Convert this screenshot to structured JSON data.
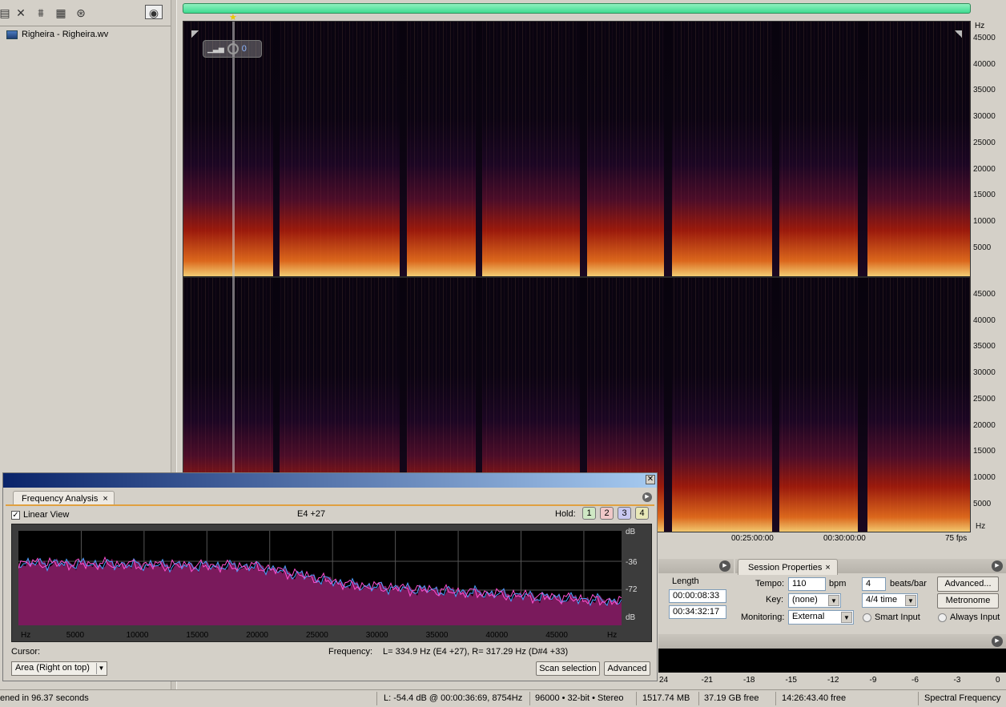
{
  "file_panel": {
    "file_name": "Righeira - Righeira.wv"
  },
  "spectral": {
    "hz_unit": "Hz",
    "hz_ticks": [
      "45000",
      "40000",
      "35000",
      "30000",
      "25000",
      "20000",
      "15000",
      "10000",
      "5000"
    ],
    "time_ticks": [
      "00:25:00:00",
      "00:30:00:00",
      "75 fps"
    ],
    "hud_value": "0"
  },
  "selection_view": {
    "length_label": "Length",
    "length_value": "00:00:08:33",
    "end_value": "00:34:32:17"
  },
  "session_properties": {
    "tab_label": "Session Properties",
    "tempo_label": "Tempo:",
    "tempo_value": "110",
    "tempo_unit": "bpm",
    "beats_value": "4",
    "beats_unit": "beats/bar",
    "advanced_button": "Advanced...",
    "key_label": "Key:",
    "key_value": "(none)",
    "time_sig_value": "4/4 time",
    "metronome_button": "Metronome",
    "monitoring_label": "Monitoring:",
    "monitoring_value": "External",
    "smart_input_label": "Smart Input",
    "always_input_label": "Always Input"
  },
  "level_meter": {
    "db_ticks": [
      "24",
      "-21",
      "-18",
      "-15",
      "-12",
      "-9",
      "-6",
      "-3",
      "0"
    ]
  },
  "frequency_analysis": {
    "tab_label": "Frequency Analysis",
    "linear_view_label": "Linear View",
    "linear_view_checked": true,
    "note_readout": "E4 +27",
    "hold_label": "Hold:",
    "hold_buttons": [
      "1",
      "2",
      "3",
      "4"
    ],
    "hold_colors": [
      "#cfe8c4",
      "#f0c8c8",
      "#c8c8f0",
      "#e8e8b8"
    ],
    "x_ticks": [
      "Hz",
      "5000",
      "10000",
      "15000",
      "20000",
      "25000",
      "30000",
      "35000",
      "40000",
      "45000",
      "Hz"
    ],
    "db_ticks": [
      "dB",
      "-36",
      "-72",
      "dB"
    ],
    "cursor_label": "Cursor:",
    "frequency_label": "Frequency:",
    "frequency_values": "L= 334.9 Hz (E4 +27), R= 317.29 Hz (D#4 +33)",
    "display_mode": "Area (Right on top)",
    "scan_button": "Scan selection",
    "advanced_button": "Advanced",
    "spectrum_color": "#7a1a5c",
    "left_line_color": "#4aa0ff",
    "right_line_color": "#ff50d0"
  },
  "status_bar": {
    "opened_text": "ened in 96.37 seconds",
    "cursor_info": "L: -54.4 dB @ 00:00:36:69, 8754Hz",
    "format": "96000 • 32-bit • Stereo",
    "size": "1517.74 MB",
    "disk_free": "37.19 GB free",
    "time_free": "14:26:43.40 free",
    "view_mode": "Spectral Frequency"
  }
}
